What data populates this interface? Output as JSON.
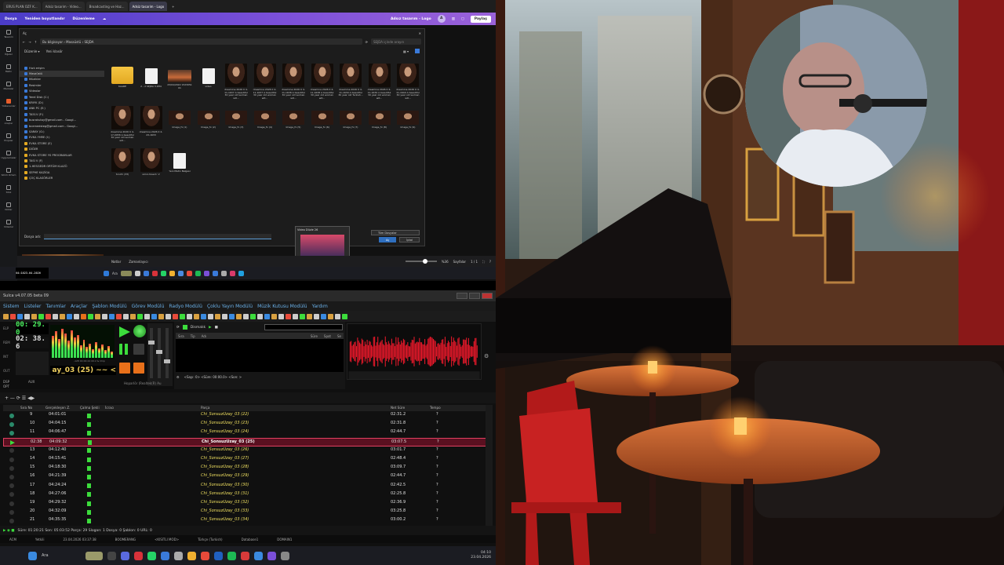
{
  "browser": {
    "tabs": [
      "ERUS PLAN OZF K...",
      "Adsiz tasarim - Video...",
      "Broadcasting ve Haz...",
      "Adsiz tasarim - Logo"
    ]
  },
  "canva": {
    "home": "Dosya",
    "resize": "Yeniden boyutlandır",
    "edit": "Düzenleme",
    "doc_title": "Adsız tasarım - Logo",
    "share": "Paylaş",
    "avatar": "A",
    "side": [
      "Tasarım",
      "Öğeler",
      "Metin",
      "Markalar",
      "Yüklenenler",
      "Araçlar",
      "Projeler",
      "Uygulamalar",
      "Sihirli Ortam",
      "Stok",
      "Notlar",
      "Videolar"
    ],
    "notes": "Notlar",
    "timer": "Zamanlayıcı",
    "pages": "Sayfalar",
    "page_count": "1 / 1",
    "zoom": "%36"
  },
  "explorer": {
    "title": "Aç",
    "breadcrumb": "Bu bilgisayar  ›  Masaüstü  ›  SEJDA",
    "search": "SEJDA içinde arayın",
    "organize": "Düzenle ▾",
    "new_folder": "Yeni klasör",
    "nav": [
      "Hızlı erişim",
      "Masaüstü",
      "Müzikler",
      "Resimler",
      "Videolar",
      "Yerel Disk (C:)",
      "KRIYK (D:)",
      "ANK PC (E:)",
      "TA51V (F:)",
      "busrakutay@gmail.com - Googl...",
      "bcemedsteg@gmail.com - Googl...",
      "SARAY (G:)",
      "EVKA YHRE (I:)",
      "EVKA STORE (E)",
      "DİĞER",
      "EVKA STORE YS PROGRAMLAR",
      "TASİ V (F)",
      "1-HESGEDR ORTÜM KLAZÖ",
      "SEPHE KAZİGA",
      "ÇOÇ KLASÖRLER"
    ],
    "files": [
      "KAARE",
      "2 - 2 SEJDA 3.0H4",
      "23/04/2022 1523051 01",
      "video",
      "dreamina 2026 0 4-11-1637 A beautiful 30 year old woman wit...",
      "dreamina 2026 0 4-11-1637 A beautiful 30 year old woman wit...",
      "dreamina 2026 0 4-11-1638 A beautiful 30 year old woman wit...",
      "dreamina 2026 0 4-11-1638 A beautiful 30 year old woman wit...",
      "dreamina 2026 0 4-11-1639 A beautiful 30 year old Turkish...",
      "dreamina 2026 0 4-11-1639 A beautiful 30 year old woman wit...",
      "dreamina 2026 0 4-11-1640 A beautiful 30 year old woman wit...",
      "dreamina 2026 0 4-17-0958 A beautiful 30 year old woman wit...",
      "dreamina 2026 0 4-23-1633",
      "Image_fx (1)",
      "Image_fx (2)",
      "Image_fx (3)",
      "Image_fx (4)",
      "Image_fx (5)",
      "Image_fx (6)",
      "Image_fx (7)",
      "Image_fx (8)",
      "Image_fx (9)",
      "tonchi (33)",
      "sünü dosed r 2",
      "Yeni Metin Belgesi"
    ],
    "filename_label": "Dosya adı:",
    "filter": "Tüm Dosyalar",
    "open": "Aç",
    "cancel": "İptal"
  },
  "popup": {
    "title": "Video Düzle 26"
  },
  "wintask": {
    "search": "Ara",
    "time": "04:10",
    "date": "23.04.2026"
  },
  "sulca": {
    "title": "Sulca v4.07.05 beta 09",
    "menu": [
      "Sistem",
      "Listeler",
      "Tanımlar",
      "Araçlar",
      "Şablon Modülü",
      "Görev Modülü",
      "Radyo Modülü",
      "Çoklu Yayın Modülü",
      "Müzik Kutusu Modülü",
      "Yardım"
    ],
    "elp": "00: 29. 0",
    "rem": "02: 38. 6",
    "elp_lbl": "ELP",
    "rem_lbl": "REM",
    "int_lbl": "INT",
    "out_lbl": "OUT",
    "now": "ay_03 (25) ~~ <",
    "tags": [
      "DSP",
      "OPT",
      "AUX"
    ],
    "mixer": "Hoparlör (Realtek(R) Au",
    "meter_vals": "-128 00:00:44 00:2 & Chip",
    "p2_mode": "Dismalık",
    "p2_cols": [
      "Sıra",
      "Tip",
      "Adı",
      "Süre",
      "Spot",
      "Se"
    ],
    "p2_foot": "<Sayı: 0>   <Süre: 00:00.0>   <Son: >",
    "playlist_icons": "+ — ⟳ ☰ ◀▶",
    "headers": [
      "Sıra No",
      "Gerçekleşen Z.",
      "Çalma Şekli",
      "İcracı",
      "Parça",
      "Net Süre",
      "Tempo"
    ],
    "rows": [
      {
        "no": "9",
        "time": "04:01:01",
        "title": "Chi_SonsuzUzay_03 (22)",
        "dur": "02:31.2",
        "tempo": "?"
      },
      {
        "no": "10",
        "time": "04:04:15",
        "title": "Chi_SonsuzUzay_03 (23)",
        "dur": "02:31.8",
        "tempo": "?"
      },
      {
        "no": "11",
        "time": "04:06:47",
        "title": "Chi_SonsuzUzay_03 (24)",
        "dur": "02:44.7",
        "tempo": "?"
      },
      {
        "no": "02:38",
        "time": "04:09:32",
        "title": "Chi_SonsuzUzay_03 (25)",
        "dur": "03:07.5",
        "tempo": "?"
      },
      {
        "no": "13",
        "time": "04:12:40",
        "title": "Chi_SonsuzUzay_03 (26)",
        "dur": "03:01.7",
        "tempo": "?"
      },
      {
        "no": "14",
        "time": "04:15:41",
        "title": "Chi_SonsuzUzay_03 (27)",
        "dur": "02:48.4",
        "tempo": "?"
      },
      {
        "no": "15",
        "time": "04:18:30",
        "title": "Chi_SonsuzUzay_03 (28)",
        "dur": "03:09.7",
        "tempo": "?"
      },
      {
        "no": "16",
        "time": "04:21:39",
        "title": "Chi_SonsuzUzay_03 (29)",
        "dur": "02:44.7",
        "tempo": "?"
      },
      {
        "no": "17",
        "time": "04:24:24",
        "title": "Chi_SonsuzUzay_03 (30)",
        "dur": "02:42.5",
        "tempo": "?"
      },
      {
        "no": "18",
        "time": "04:27:06",
        "title": "Chi_SonsuzUzay_03 (31)",
        "dur": "02:25.8",
        "tempo": "?"
      },
      {
        "no": "19",
        "time": "04:29:32",
        "title": "Chi_SonsuzUzay_03 (32)",
        "dur": "02:36.9",
        "tempo": "?"
      },
      {
        "no": "20",
        "time": "04:32:09",
        "title": "Chi_SonsuzUzay_03 (33)",
        "dur": "03:25.8",
        "tempo": "?"
      },
      {
        "no": "21",
        "time": "04:35:35",
        "title": "Chi_SonsuzUzay_03 (34)",
        "dur": "03:00.2",
        "tempo": "?"
      }
    ],
    "current_index": 3,
    "status": "Süre: 01:20:21  Son: 05:03:52  Parça: 29  Slogan: 1  Dosya: 0  Şablon: 0  URL: 0",
    "status2": [
      "ACM",
      "Yetkili",
      "23.04.2026 03:37:38",
      "BOOMERANG",
      "<KISITLI MOD>",
      "Türkçe (Turkish)",
      "Database1",
      "DOMAIN1"
    ]
  },
  "taskbar": {
    "search": "Ara",
    "time": "04:10",
    "date": "23.04.2026"
  },
  "colors": {
    "canva_accent": "#7a4fd8",
    "current_row": "#5a1020",
    "waveform": "#e8182a"
  }
}
